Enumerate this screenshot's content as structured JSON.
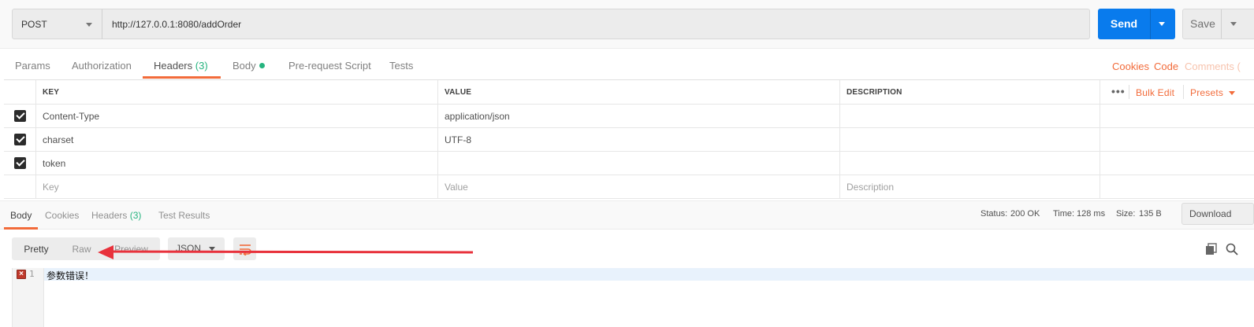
{
  "request": {
    "method": "POST",
    "url": "http://127.0.0.1:8080/addOrder",
    "send_label": "Send",
    "save_label": "Save"
  },
  "request_tabs": {
    "params": "Params",
    "authorization": "Authorization",
    "headers": "Headers",
    "headers_count": "(3)",
    "body": "Body",
    "prerequest": "Pre-request Script",
    "tests": "Tests"
  },
  "request_links": {
    "cookies": "Cookies",
    "code": "Code",
    "comments": "Comments ("
  },
  "headers_table": {
    "columns": {
      "key": "KEY",
      "value": "VALUE",
      "description": "DESCRIPTION"
    },
    "actions": {
      "more": "•••",
      "bulk_edit": "Bulk Edit",
      "presets": "Presets"
    },
    "rows": [
      {
        "checked": true,
        "key": "Content-Type",
        "value": "application/json",
        "description": ""
      },
      {
        "checked": true,
        "key": "charset",
        "value": "UTF-8",
        "description": ""
      },
      {
        "checked": true,
        "key": "token",
        "value": "",
        "description": ""
      }
    ],
    "placeholder": {
      "key": "Key",
      "value": "Value",
      "description": "Description"
    }
  },
  "response_tabs": {
    "body": "Body",
    "cookies": "Cookies",
    "headers": "Headers",
    "headers_count": "(3)",
    "test_results": "Test Results"
  },
  "response_meta": {
    "status_label": "Status:",
    "status_value": "200 OK",
    "time_label": "Time:",
    "time_value": "128 ms",
    "size_label": "Size:",
    "size_value": "135 B",
    "download_label": "Download"
  },
  "response_toolbar": {
    "pretty": "Pretty",
    "raw": "Raw",
    "preview": "Preview",
    "format": "JSON"
  },
  "response_body": {
    "line_number": "1",
    "text": "参数错误！"
  },
  "colors": {
    "accent_orange": "#f26b3a",
    "send_blue": "#097bed",
    "ok_green": "#26b47f",
    "annotation_red": "#e8323c"
  },
  "icons": [
    "dropdown-caret-icon",
    "checkbox-checked-icon",
    "wrap-lines-icon",
    "copy-icon",
    "search-icon",
    "error-marker-icon"
  ]
}
